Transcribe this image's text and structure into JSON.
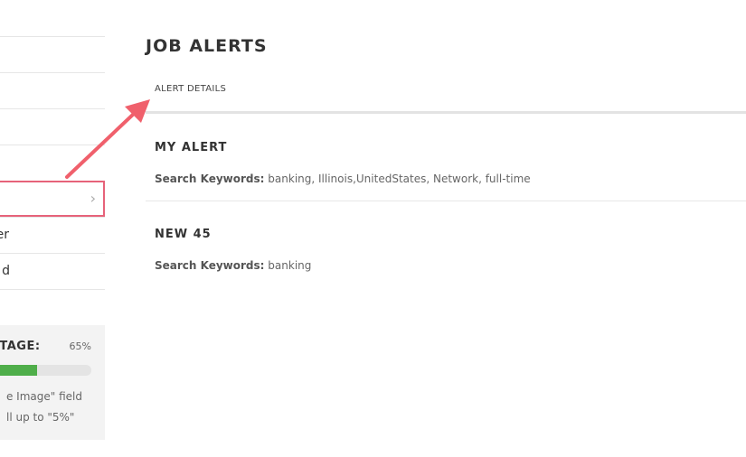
{
  "sidebar": {
    "items": [
      {
        "label": ""
      },
      {
        "label": ""
      },
      {
        "label": ""
      },
      {
        "label": ""
      },
      {
        "label": "",
        "active": true
      },
      {
        "label": "er"
      },
      {
        "label": "d"
      }
    ],
    "completion": {
      "title": "TAGE:",
      "percent_text": "65%",
      "percent": 65,
      "hint_line1": "e Image\" field",
      "hint_line2": "ll up to \"5%\""
    }
  },
  "main": {
    "title": "JOB ALERTS",
    "tab_label": "ALERT DETAILS",
    "alerts": [
      {
        "name": "MY ALERT",
        "keywords_label": "Search Keywords:",
        "keywords": "banking, Illinois,UnitedStates, Network, full-time"
      },
      {
        "name": "NEW 45",
        "keywords_label": "Search Keywords:",
        "keywords": "banking"
      }
    ]
  },
  "colors": {
    "accent_border": "#e6637a",
    "progress": "#4fae4a",
    "arrow": "#f0606c"
  },
  "icons": {
    "active_item": "chevron-right-icon",
    "annotation": "arrow-annotation-icon"
  }
}
